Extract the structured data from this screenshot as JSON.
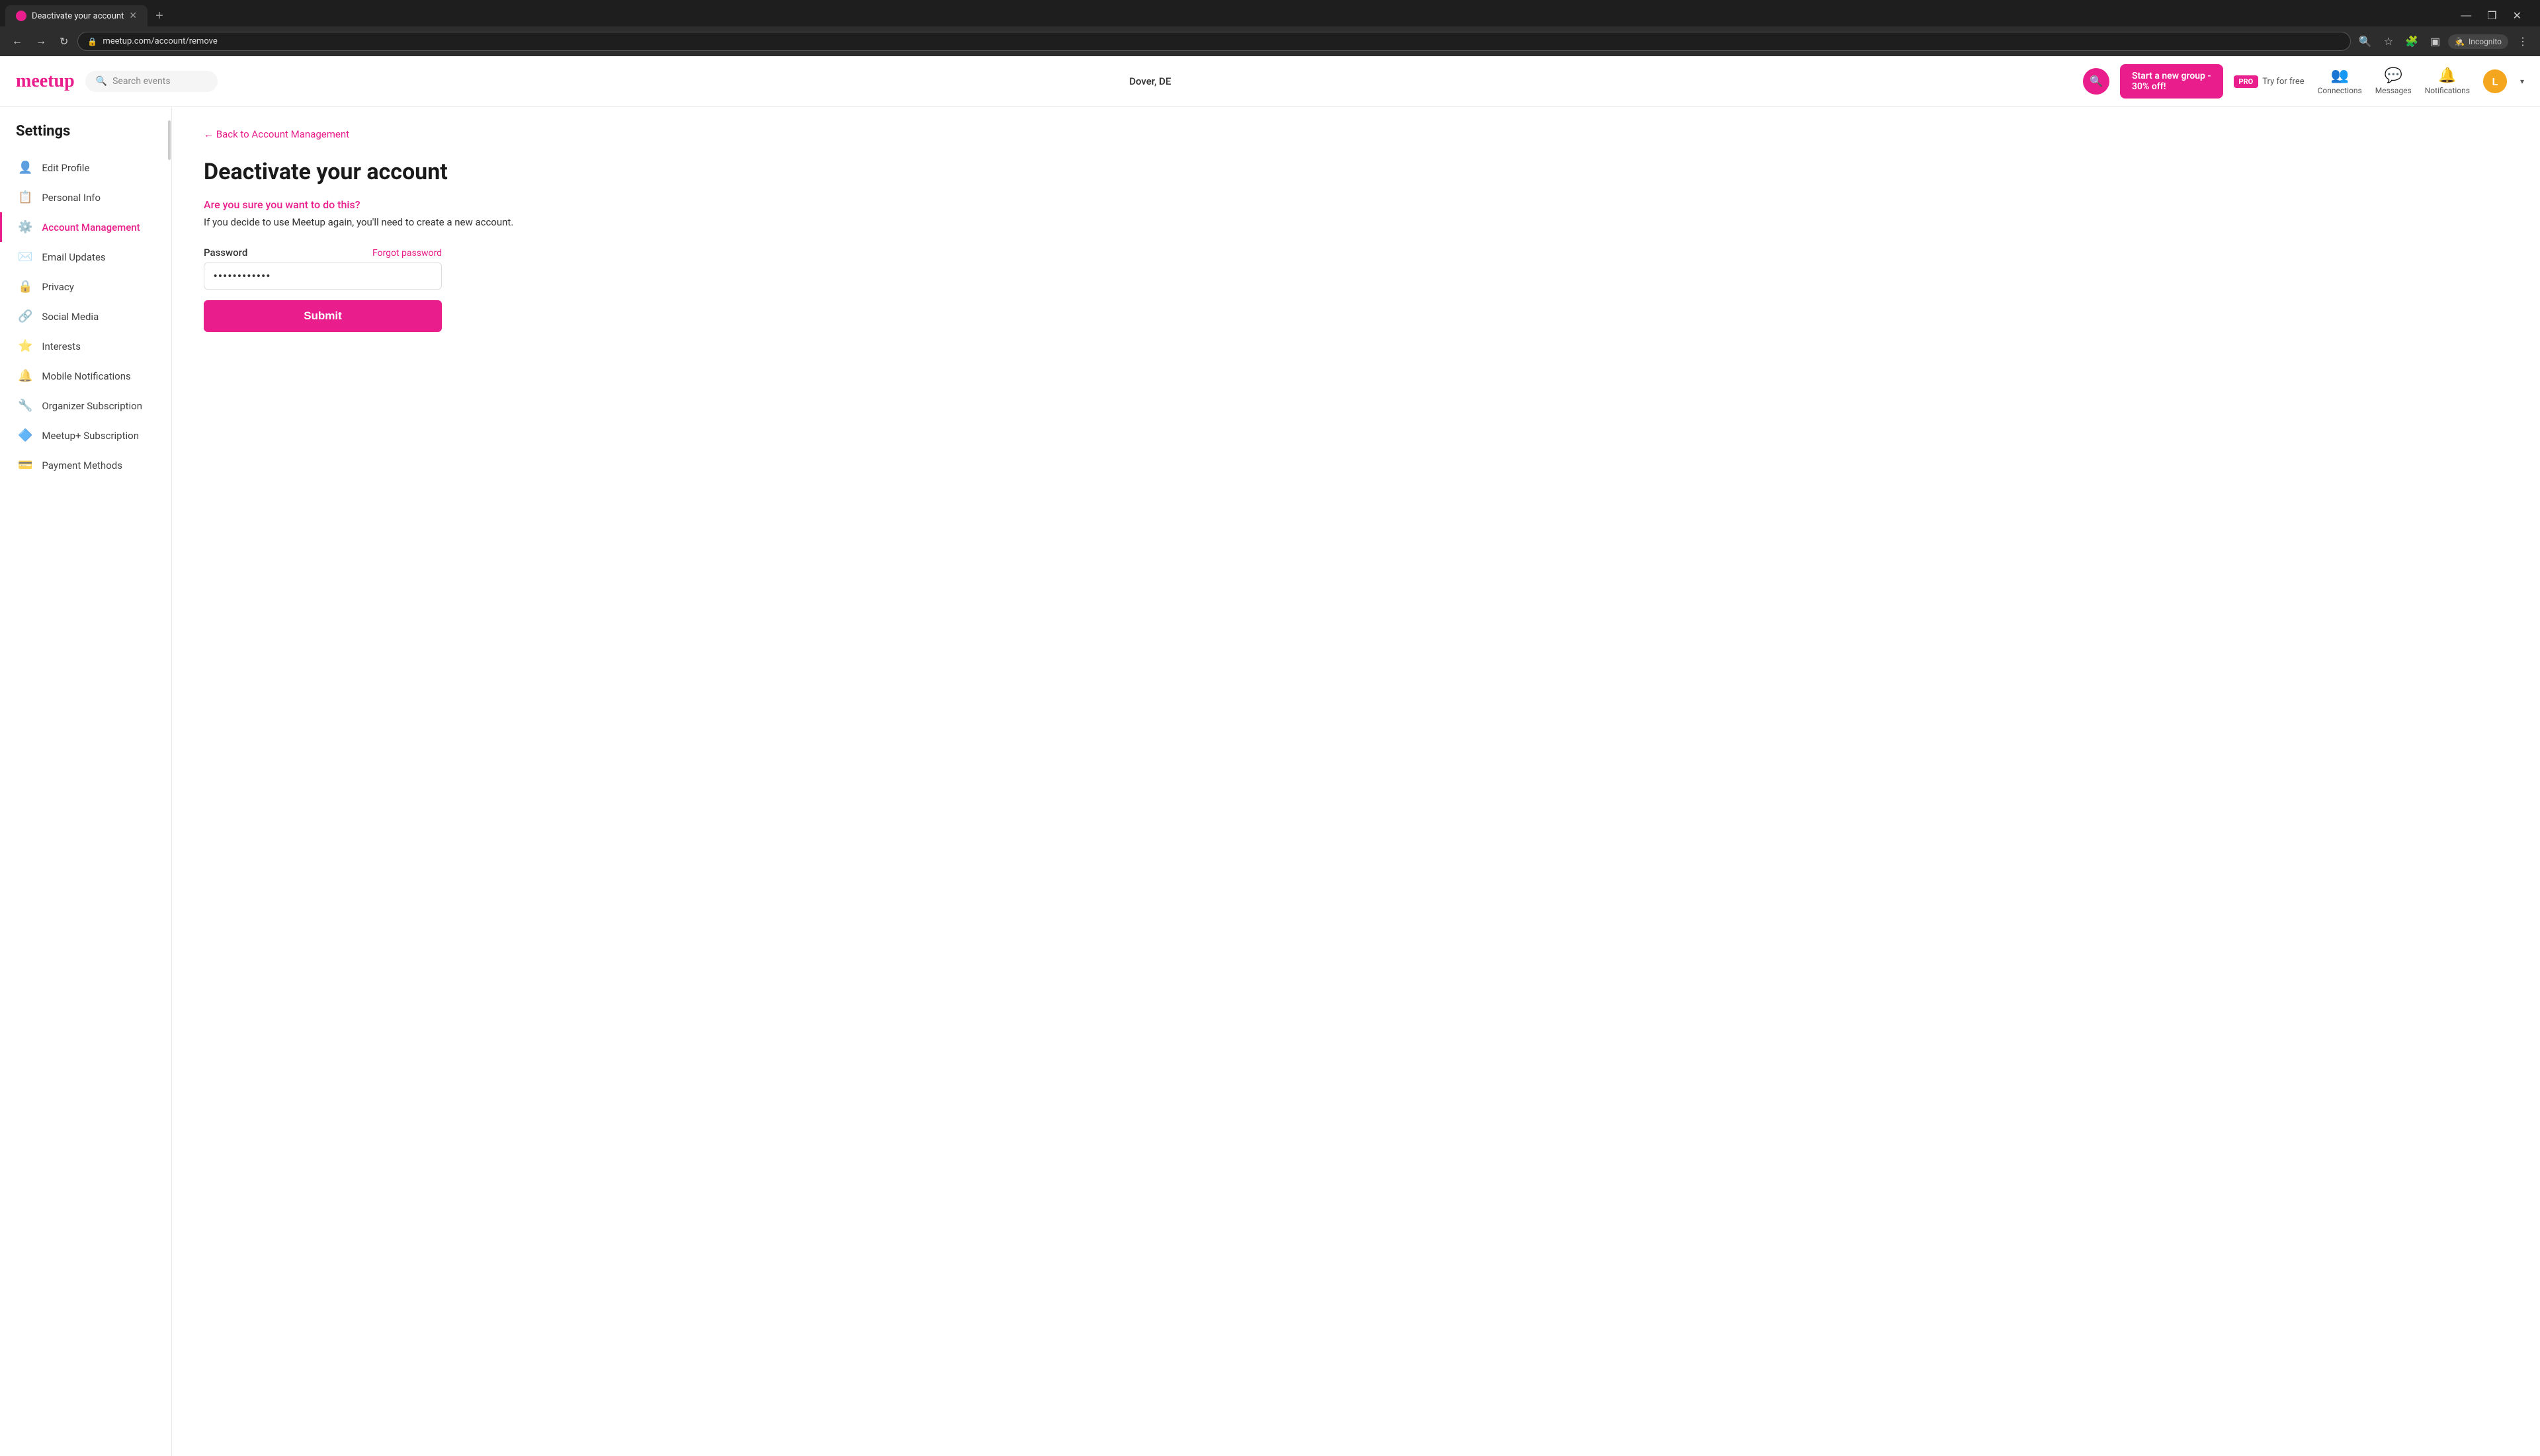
{
  "browser": {
    "tab_title": "Deactivate your account",
    "tab_favicon": "M",
    "url": "meetup.com/account/remove",
    "new_tab_label": "+",
    "nav": {
      "back_label": "←",
      "forward_label": "→",
      "refresh_label": "↻"
    },
    "toolbar_right": {
      "incognito_label": "Incognito",
      "menu_label": "⋮"
    },
    "win_controls": {
      "minimize": "—",
      "maximize": "❐",
      "close": "✕"
    }
  },
  "header": {
    "logo": "meetup",
    "search_placeholder": "Search events",
    "location": "Dover, DE",
    "promo": {
      "line1": "Start a new group -",
      "line2": "30% off!",
      "search_icon": "🔍"
    },
    "pro_badge": "PRO",
    "try_free": "Try for free",
    "connections_label": "Connections",
    "messages_label": "Messages",
    "notifications_label": "Notifications",
    "avatar_initial": "L"
  },
  "sidebar": {
    "title": "Settings",
    "items": [
      {
        "id": "edit-profile",
        "label": "Edit Profile",
        "icon": "👤"
      },
      {
        "id": "personal-info",
        "label": "Personal Info",
        "icon": "📋"
      },
      {
        "id": "account-management",
        "label": "Account Management",
        "icon": "⚙️",
        "active": true
      },
      {
        "id": "email-updates",
        "label": "Email Updates",
        "icon": "✉️"
      },
      {
        "id": "privacy",
        "label": "Privacy",
        "icon": "🔒"
      },
      {
        "id": "social-media",
        "label": "Social Media",
        "icon": "🔗"
      },
      {
        "id": "interests",
        "label": "Interests",
        "icon": "⭐"
      },
      {
        "id": "mobile-notifications",
        "label": "Mobile Notifications",
        "icon": "🔔"
      },
      {
        "id": "organizer-subscription",
        "label": "Organizer Subscription",
        "icon": "🔧"
      },
      {
        "id": "meetup-subscription",
        "label": "Meetup+ Subscription",
        "icon": "🔷"
      },
      {
        "id": "payment-methods",
        "label": "Payment Methods",
        "icon": "💳"
      }
    ]
  },
  "main": {
    "back_link": "← Back to Account Management",
    "page_title": "Deactivate your account",
    "warning_text": "Are you sure you want to do this?",
    "info_text": "If you decide to use Meetup again, you'll need to create a new account.",
    "form": {
      "password_label": "Password",
      "forgot_password_label": "Forgot password",
      "password_value": "............",
      "submit_label": "Submit"
    }
  }
}
